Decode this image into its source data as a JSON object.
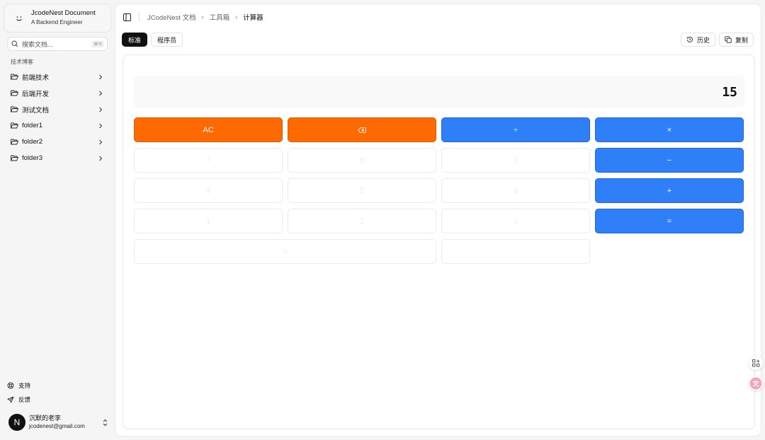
{
  "brand": {
    "title": "JcodeNest Document",
    "subtitle": "A Backend Engineer"
  },
  "search": {
    "placeholder": "搜索文档...",
    "shortcut": "⌘ K"
  },
  "sidebar": {
    "section_label": "技术博客",
    "items": [
      {
        "label": "前端技术"
      },
      {
        "label": "后端开发"
      },
      {
        "label": "测试文档"
      },
      {
        "label": "folder1"
      },
      {
        "label": "folder2"
      },
      {
        "label": "folder3"
      }
    ],
    "footer": {
      "support": "支持",
      "feedback": "反馈"
    },
    "user": {
      "avatar_letter": "N",
      "name": "沉默的老李",
      "email": "jcodenest@gmail.com"
    }
  },
  "breadcrumb": {
    "root": "JCodeNest 文档",
    "parent": "工具箱",
    "current": "计算器"
  },
  "tabs": {
    "standard": "标准",
    "programmer": "程序员"
  },
  "actions": {
    "history": "历史",
    "copy": "复制"
  },
  "calculator": {
    "display": "15",
    "keys": {
      "clear": "AC",
      "backspace": "⌫",
      "divide": "÷",
      "multiply": "×",
      "seven": "7",
      "eight": "8",
      "nine": "9",
      "minus": "−",
      "four": "4",
      "five": "5",
      "six": "6",
      "plus": "+",
      "one": "1",
      "two": "2",
      "three": "3",
      "equals": "=",
      "zero": "0",
      "dot": "."
    }
  },
  "colors": {
    "operator_blue": "#2f7ff8",
    "clear_orange": "#ff6a00",
    "active_tab": "#111111"
  }
}
